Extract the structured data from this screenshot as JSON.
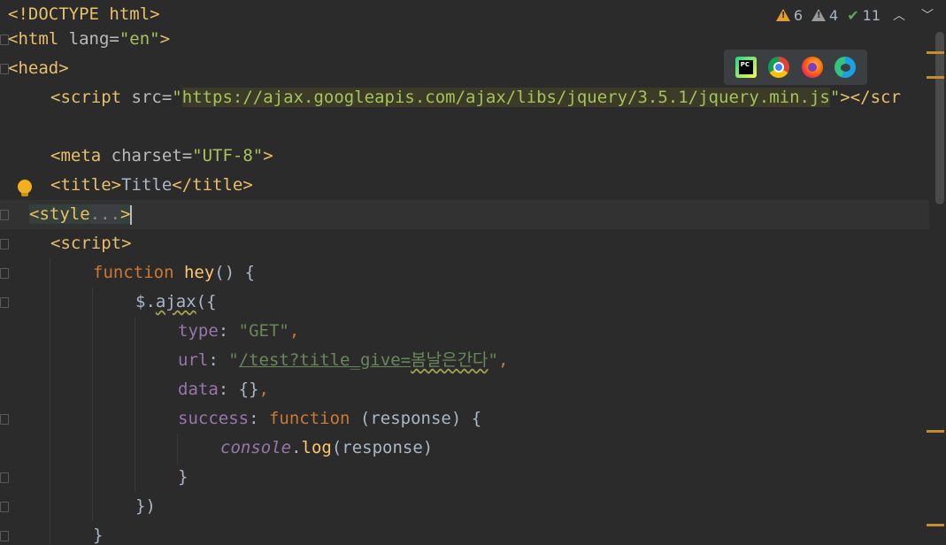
{
  "code": {
    "l1": "<!DOCTYPE html>",
    "l2_open": "<html ",
    "l2_attr": "lang=",
    "l2_val": "\"en\"",
    "l2_close": ">",
    "l3": "<head>",
    "l4_open": "<script ",
    "l4_attr": "src=",
    "l4_q1": "\"",
    "l4_url": "https://ajax.googleapis.com/ajax/libs/jquery/3.5.1/jquery.min.js",
    "l4_q2": "\"",
    "l4_close": "></scr",
    "l6_open": "<meta ",
    "l6_attr": "charset=",
    "l6_val": "\"UTF-8\"",
    "l6_close": ">",
    "l7_open": "<title>",
    "l7_text": "Title",
    "l7_close": "</title>",
    "l8_open": "<style",
    "l8_fold": "...",
    "l8_close": ">",
    "l9": "<script>",
    "l10_kw": "function ",
    "l10_fn": "hey",
    "l10_rest": "() {",
    "l11_dollar": "$.",
    "l11_ajax": "ajax",
    "l11_rest": "({",
    "l12_prop": "type",
    "l12_colon": ": ",
    "l12_val": "\"GET\"",
    "l12_comma": ",",
    "l13_prop": "url",
    "l13_colon": ": ",
    "l13_q1": "\"",
    "l13_path": "/test?title_give=",
    "l13_korean": "봄날은간다",
    "l13_q2": "\"",
    "l13_comma": ",",
    "l14_prop": "data",
    "l14_rest": ": {}",
    "l14_comma": ",",
    "l15_prop": "success",
    "l15_colon": ": ",
    "l15_kw": "function ",
    "l15_rest": "(response) {",
    "l16_console": "console",
    "l16_dot": ".",
    "l16_log": "log",
    "l16_rest": "(response)",
    "l17": "}",
    "l18": "})",
    "l19": "}"
  },
  "status": {
    "warnings_count": "6",
    "weak_warnings_count": "4",
    "ok_count": "11",
    "up_label": "⌃",
    "down_label": "⌄"
  },
  "browsers": [
    "PyCharm",
    "Chrome",
    "Firefox",
    "Edge"
  ],
  "colors": {
    "background": "#2b2b2b",
    "tag": "#e8bf6a",
    "keyword": "#cc7832",
    "string": "#6a8759",
    "property": "#9876aa"
  }
}
